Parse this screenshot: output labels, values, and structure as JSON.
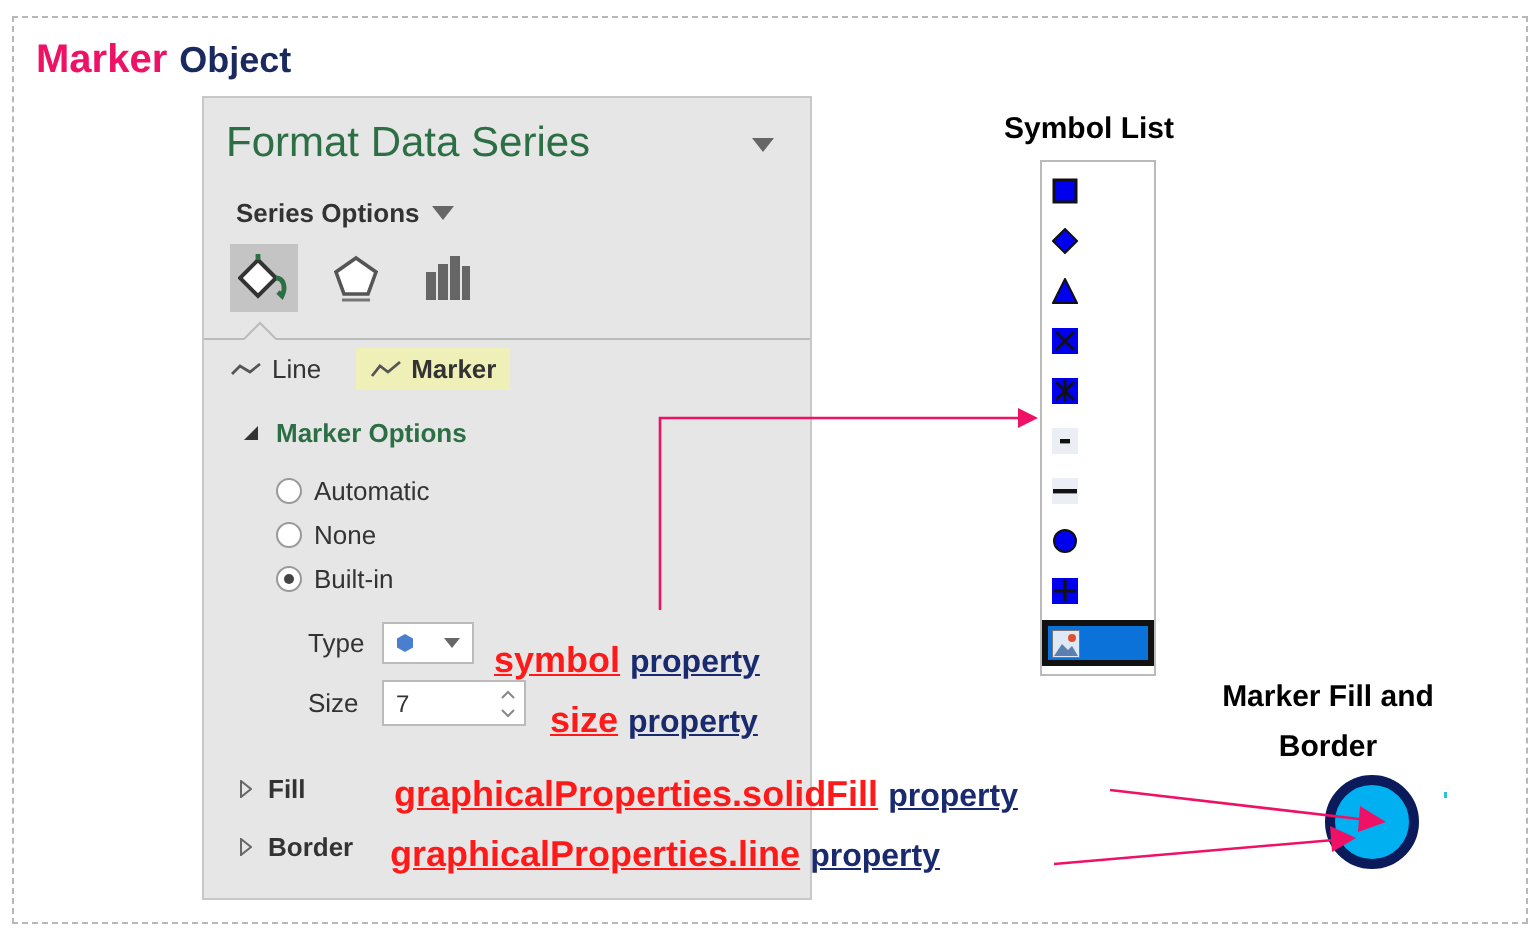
{
  "title": {
    "accent": "Marker",
    "rest": "Object"
  },
  "panel": {
    "title": "Format Data Series",
    "section": "Series Options",
    "icon_tabs": [
      {
        "kind": "fill",
        "selected": true
      },
      {
        "kind": "effects",
        "selected": false
      },
      {
        "kind": "series",
        "selected": false
      }
    ],
    "subtabs": [
      {
        "label": "Line",
        "selected": false
      },
      {
        "label": "Marker",
        "selected": true
      }
    ],
    "group": {
      "label": "Marker Options",
      "expanded": true
    },
    "radios": [
      {
        "label": "Automatic",
        "selected": false
      },
      {
        "label": "None",
        "selected": false
      },
      {
        "label": "Built-in",
        "selected": true
      }
    ],
    "type": {
      "label": "Type"
    },
    "size": {
      "label": "Size",
      "value": "7"
    },
    "sections": [
      {
        "label": "Fill",
        "expanded": false
      },
      {
        "label": "Border",
        "expanded": false
      }
    ]
  },
  "annotations": [
    {
      "name": "symbol",
      "word": "property"
    },
    {
      "name": "size",
      "word": "property"
    },
    {
      "name": "graphicalProperties.solidFill",
      "word": "property"
    },
    {
      "name": "graphicalProperties.line",
      "word": "property"
    }
  ],
  "symbol_list": {
    "title": "Symbol List",
    "symbols": [
      {
        "kind": "square",
        "selected": false
      },
      {
        "kind": "diamond",
        "selected": false
      },
      {
        "kind": "triangle",
        "selected": false
      },
      {
        "kind": "x",
        "selected": false
      },
      {
        "kind": "star",
        "selected": false
      },
      {
        "kind": "dash",
        "selected": false
      },
      {
        "kind": "longdash",
        "selected": false
      },
      {
        "kind": "circle",
        "selected": false
      },
      {
        "kind": "plus",
        "selected": false
      },
      {
        "kind": "picture",
        "selected": true
      }
    ]
  },
  "marker_demo": {
    "title": "Marker Fill and Border"
  }
}
